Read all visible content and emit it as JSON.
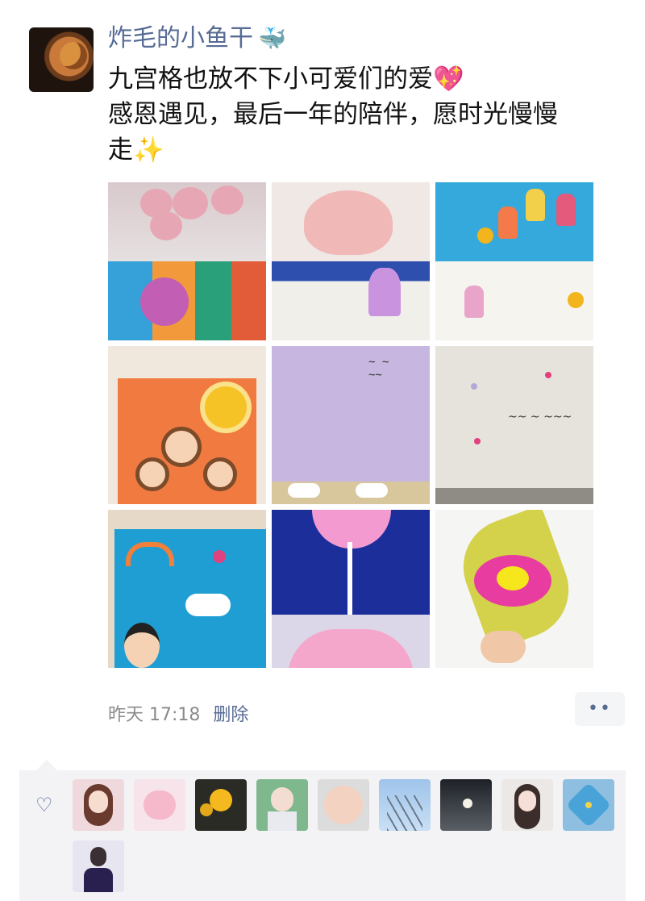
{
  "post": {
    "author_name": "炸毛的小鱼干",
    "author_emoji": "🐳",
    "text_line1": "九宫格也放不下小可爱们的爱",
    "text_line1_emoji": "💖",
    "text_line2": "感恩遇见，最后一年的陪伴，愿时光慢慢",
    "text_line3": "走",
    "text_line3_emoji": "✨",
    "time": "昨天 17:18",
    "delete_label": "删除",
    "more_label": "••"
  },
  "images": [
    {
      "name": "photo-1"
    },
    {
      "name": "photo-2"
    },
    {
      "name": "photo-3"
    },
    {
      "name": "photo-4"
    },
    {
      "name": "photo-5"
    },
    {
      "name": "photo-6"
    },
    {
      "name": "photo-7"
    },
    {
      "name": "photo-8"
    },
    {
      "name": "photo-9"
    }
  ],
  "likes": {
    "icon": "heart-outline-icon",
    "avatars": [
      {
        "name": "liker-1"
      },
      {
        "name": "liker-2"
      },
      {
        "name": "liker-3"
      },
      {
        "name": "liker-4"
      },
      {
        "name": "liker-5"
      },
      {
        "name": "liker-6"
      },
      {
        "name": "liker-7"
      },
      {
        "name": "liker-8"
      },
      {
        "name": "liker-9"
      },
      {
        "name": "liker-10"
      }
    ]
  },
  "colors": {
    "link": "#576b95",
    "meta": "#8b8b8b",
    "likes_bg": "#f3f3f5"
  }
}
